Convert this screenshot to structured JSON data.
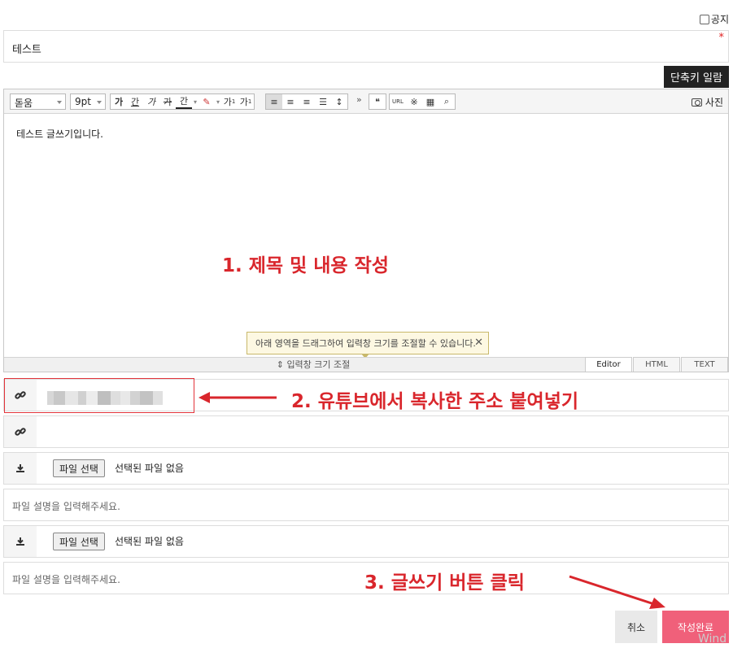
{
  "notice": {
    "label": "공지",
    "checked": false
  },
  "subject": {
    "value": "테스트",
    "required_mark": "*"
  },
  "shortcut_button": "단축키 일람",
  "toolbar": {
    "font": "돋움",
    "size": "9pt",
    "format_buttons": [
      "가",
      "간",
      "가",
      "가",
      "간"
    ],
    "superscript": "가",
    "subscript": "가",
    "quote": "❝",
    "url": "URL",
    "photo": "사진"
  },
  "editor": {
    "content": "테스트 글쓰기입니다.",
    "tooltip": "아래 영역을 드래그하여 입력창 크기를 조절할 수 있습니다.",
    "tooltip_close": "✕",
    "resize_label": "입력창 크기 조절",
    "modes": [
      "Editor",
      "HTML",
      "TEXT"
    ]
  },
  "annotations": {
    "step1": "1. 제목 및 내용 작성",
    "step2": "2. 유튜브에서 복사한 주소 붙여넣기",
    "step3": "3. 글쓰기 버튼 클릭"
  },
  "attachments": {
    "file_button": "파일 선택",
    "no_file": "선택된 파일 없음",
    "desc_placeholder": "파일 설명을 입력해주세요."
  },
  "buttons": {
    "cancel": "취소",
    "submit": "작성완료"
  },
  "watermark": "Wind",
  "colors": {
    "annotation": "#d9262c",
    "submit": "#f0607a",
    "shortcut_bg": "#222222"
  }
}
